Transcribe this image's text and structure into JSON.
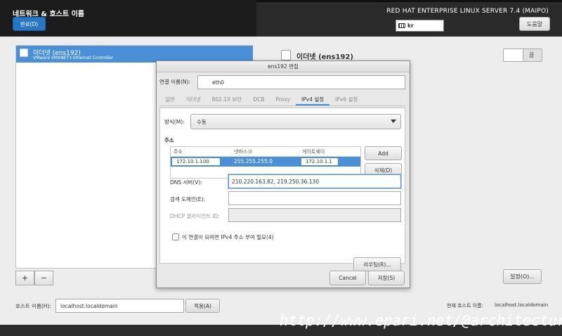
{
  "header": {
    "title": "네트워크 & 호스트 이름",
    "done_label": "완료(D)",
    "product": "RED HAT ENTERPRISE LINUX SERVER 7.4 (MAIPO)",
    "keyboard": "kr",
    "help_label": "도움말"
  },
  "connections": [
    {
      "name": "이더넷 (ens192)",
      "desc": "VMware VMXNET3 Ethernet Controller"
    }
  ],
  "list_controls": {
    "add": "+",
    "remove": "−"
  },
  "detail": {
    "title": "이더넷 (ens192)",
    "toggle_label": "끔",
    "settings_label": "설정(O)..."
  },
  "hostname": {
    "label": "호스트 이름(H):",
    "value": "localhost.localdomain",
    "apply_label": "적용(A)",
    "current_label": "현재 호스트 이름:",
    "current_value": "localhost.localdomain"
  },
  "watermark": "http://www.epari.net/@architecture",
  "dialog": {
    "title": "ens192 편집",
    "conn_name_label": "연결 이름(N):",
    "conn_name_value": "eth0",
    "tabs": [
      "일반",
      "이더넷",
      "802.1X 보안",
      "DCB",
      "Proxy",
      "IPv4 설정",
      "IPv6 설정"
    ],
    "active_tab": "IPv4 설정",
    "method_label": "방식(M):",
    "method_value": "수동",
    "address_section": "주소",
    "address_columns": [
      "주소",
      "넷마스크",
      "게이트웨이"
    ],
    "address_rows": [
      {
        "address": "172.10.1.100",
        "netmask": "255.255.255.0",
        "gateway": "172.10.1.1"
      }
    ],
    "add_label": "Add",
    "delete_label": "삭제(D)",
    "dns_label": "DNS 서버(V):",
    "dns_value": "210.220.163.82, 219.250.36.130",
    "search_label": "검색 도메인(E):",
    "search_value": "",
    "dhcp_label": "DHCP 클라이언트 ID:",
    "dhcp_value": "",
    "require_ipv4_label": "이 연결이 되려면 IPv4 주소 부여 필요(4)",
    "require_ipv4_checked": false,
    "routes_label": "라우팅(R)...",
    "cancel_label": "Cancel",
    "save_label": "저장(S)"
  }
}
